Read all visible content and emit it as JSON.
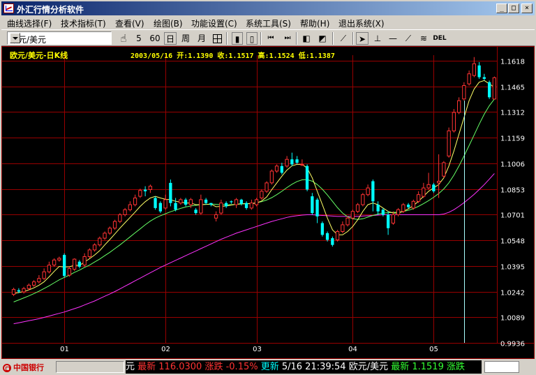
{
  "window": {
    "title": "外汇行情分析软件",
    "btn_min": "_",
    "btn_max": "□",
    "btn_close": "×"
  },
  "menu": [
    "曲线选择(F)",
    "技术指标(T)",
    "查看(V)",
    "绘图(B)",
    "功能设置(C)",
    "系统工具(S)",
    "帮助(H)",
    "退出系统(X)"
  ],
  "toolbar": {
    "instrument": "欧元/美元",
    "minute5": "5",
    "minute60": "60",
    "day": "日",
    "week": "周",
    "month": "月",
    "del": "DEL"
  },
  "chart": {
    "instrument_label": "欧元/美元-日K线",
    "info_line": "2003/05/16  开:1.1390  收:1.1517  高:1.1524  低:1.1387",
    "colors": {
      "up": "#ff3333",
      "down": "#00ffff",
      "grid": "#990000",
      "axis_text": "#ffffff",
      "ma_short": "#ffff66",
      "ma_mid": "#66ff66",
      "ma_long": "#ff33ff"
    }
  },
  "chart_data": {
    "type": "candlestick",
    "y_ticks": [
      "1.1618",
      "1.1465",
      "1.1312",
      "1.1159",
      "1.1006",
      "1.0853",
      "1.0701",
      "1.0548",
      "1.0395",
      "1.0242",
      "1.0089",
      "0.9936"
    ],
    "ylim": [
      0.9936,
      1.1618
    ],
    "x_ticks": [
      {
        "label": "01",
        "index": 10
      },
      {
        "label": "02",
        "index": 30
      },
      {
        "label": "03",
        "index": 48
      },
      {
        "label": "04",
        "index": 67
      },
      {
        "label": "05",
        "index": 83
      }
    ],
    "candles": [
      [
        1.0225,
        1.0255,
        1.0215,
        1.0265
      ],
      [
        1.025,
        1.0242,
        1.0232,
        1.0262
      ],
      [
        1.024,
        1.026,
        1.023,
        1.027
      ],
      [
        1.026,
        1.028,
        1.025,
        1.029
      ],
      [
        1.028,
        1.03,
        1.027,
        1.031
      ],
      [
        1.03,
        1.032,
        1.029,
        1.034
      ],
      [
        1.032,
        1.036,
        1.031,
        1.038
      ],
      [
        1.036,
        1.04,
        1.035,
        1.042
      ],
      [
        1.04,
        1.043,
        1.039,
        1.044
      ],
      [
        1.043,
        1.044,
        1.042,
        1.045
      ],
      [
        1.046,
        1.0335,
        1.0325,
        1.047
      ],
      [
        1.034,
        1.038,
        1.033,
        1.039
      ],
      [
        1.0375,
        1.0435,
        1.0365,
        1.044
      ],
      [
        1.042,
        1.039,
        1.038,
        1.043
      ],
      [
        1.04,
        1.045,
        1.039,
        1.047
      ],
      [
        1.045,
        1.049,
        1.044,
        1.05
      ],
      [
        1.049,
        1.052,
        1.048,
        1.053
      ],
      [
        1.052,
        1.056,
        1.051,
        1.057
      ],
      [
        1.056,
        1.059,
        1.055,
        1.06
      ],
      [
        1.059,
        1.062,
        1.058,
        1.063
      ],
      [
        1.062,
        1.066,
        1.061,
        1.067
      ],
      [
        1.066,
        1.07,
        1.065,
        1.071
      ],
      [
        1.07,
        1.073,
        1.069,
        1.074
      ],
      [
        1.073,
        1.076,
        1.072,
        1.078
      ],
      [
        1.076,
        1.08,
        1.075,
        1.082
      ],
      [
        1.081,
        1.0845,
        1.08,
        1.0855
      ],
      [
        1.085,
        1.084,
        1.081,
        1.087
      ],
      [
        1.085,
        1.087,
        1.083,
        1.088
      ],
      [
        1.08,
        1.074,
        1.073,
        1.081
      ],
      [
        1.077,
        1.072,
        1.071,
        1.078
      ],
      [
        1.074,
        1.079,
        1.073,
        1.082
      ],
      [
        1.089,
        1.077,
        1.075,
        1.091
      ],
      [
        1.077,
        1.073,
        1.072,
        1.08
      ],
      [
        1.077,
        1.079,
        1.076,
        1.08
      ],
      [
        1.079,
        1.076,
        1.075,
        1.08
      ],
      [
        1.076,
        1.079,
        1.074,
        1.08
      ],
      [
        1.073,
        1.071,
        1.07,
        1.074
      ],
      [
        1.071,
        1.079,
        1.07,
        1.082
      ],
      [
        1.079,
        1.077,
        1.076,
        1.08
      ],
      [
        1.077,
        1.076,
        1.075,
        1.077
      ],
      [
        1.068,
        1.07,
        1.066,
        1.072
      ],
      [
        1.071,
        1.077,
        1.07,
        1.079
      ],
      [
        1.077,
        1.075,
        1.074,
        1.078
      ],
      [
        1.078,
        1.0775,
        1.0765,
        1.0785
      ],
      [
        1.076,
        1.079,
        1.074,
        1.08
      ],
      [
        1.079,
        1.0765,
        1.0755,
        1.0795
      ],
      [
        1.077,
        1.074,
        1.073,
        1.078
      ],
      [
        1.074,
        1.077,
        1.073,
        1.079
      ],
      [
        1.076,
        1.079,
        1.075,
        1.08
      ],
      [
        1.08,
        1.084,
        1.079,
        1.085
      ],
      [
        1.084,
        1.089,
        1.083,
        1.09
      ],
      [
        1.089,
        1.096,
        1.088,
        1.097
      ],
      [
        1.096,
        1.099,
        1.095,
        1.1
      ],
      [
        1.099,
        1.095,
        1.094,
        1.101
      ],
      [
        1.099,
        1.103,
        1.098,
        1.105
      ],
      [
        1.103,
        1.1,
        1.099,
        1.107
      ],
      [
        1.103,
        1.101,
        1.1,
        1.105
      ],
      [
        1.1,
        1.1,
        1.099,
        1.103
      ],
      [
        1.099,
        1.085,
        1.084,
        1.1
      ],
      [
        1.081,
        1.071,
        1.07,
        1.083
      ],
      [
        1.079,
        1.069,
        1.065,
        1.08
      ],
      [
        1.065,
        1.058,
        1.057,
        1.066
      ],
      [
        1.059,
        1.055,
        1.054,
        1.06
      ],
      [
        1.056,
        1.052,
        1.051,
        1.057
      ],
      [
        1.055,
        1.06,
        1.054,
        1.061
      ],
      [
        1.06,
        1.064,
        1.059,
        1.066
      ],
      [
        1.064,
        1.068,
        1.063,
        1.069
      ],
      [
        1.068,
        1.072,
        1.067,
        1.073
      ],
      [
        1.072,
        1.076,
        1.071,
        1.077
      ],
      [
        1.076,
        1.082,
        1.075,
        1.083
      ],
      [
        1.082,
        1.086,
        1.081,
        1.088
      ],
      [
        1.09,
        1.078,
        1.072,
        1.091
      ],
      [
        1.076,
        1.072,
        1.07,
        1.078
      ],
      [
        1.073,
        1.07,
        1.069,
        1.074
      ],
      [
        1.07,
        1.062,
        1.058,
        1.072
      ],
      [
        1.065,
        1.07,
        1.064,
        1.072
      ],
      [
        1.07,
        1.073,
        1.069,
        1.074
      ],
      [
        1.072,
        1.076,
        1.071,
        1.077
      ],
      [
        1.076,
        1.0745,
        1.0735,
        1.077
      ],
      [
        1.074,
        1.078,
        1.073,
        1.079
      ],
      [
        1.078,
        1.082,
        1.077,
        1.084
      ],
      [
        1.081,
        1.086,
        1.08,
        1.089
      ],
      [
        1.086,
        1.088,
        1.085,
        1.095
      ],
      [
        1.088,
        1.084,
        1.083,
        1.089
      ],
      [
        1.089,
        1.09,
        1.08,
        1.106
      ],
      [
        1.093,
        1.101,
        1.092,
        1.102
      ],
      [
        1.105,
        1.12,
        1.104,
        1.122
      ],
      [
        1.12,
        1.131,
        1.119,
        1.133
      ],
      [
        1.131,
        1.138,
        1.13,
        1.14
      ],
      [
        1.139,
        1.147,
        1.138,
        1.149
      ],
      [
        1.148,
        1.154,
        1.147,
        1.156
      ],
      [
        1.153,
        1.16,
        1.152,
        1.164
      ],
      [
        1.159,
        1.152,
        1.151,
        1.161
      ],
      [
        1.152,
        1.151,
        1.15,
        1.154
      ],
      [
        1.149,
        1.14,
        1.139,
        1.15
      ],
      [
        1.139,
        1.1517,
        1.1387,
        1.1524
      ]
    ],
    "ma_short": [
      1.023,
      1.0236,
      1.0242,
      1.0252,
      1.0264,
      1.028,
      1.03,
      1.033,
      1.0362,
      1.0392,
      1.0388,
      1.039,
      1.0398,
      1.0398,
      1.0418,
      1.0438,
      1.046,
      1.0486,
      1.052,
      1.0552,
      1.0586,
      1.062,
      1.0652,
      1.0684,
      1.0716,
      1.075,
      1.0778,
      1.08,
      1.081,
      1.08,
      1.0792,
      1.079,
      1.078,
      1.0776,
      1.077,
      1.077,
      1.076,
      1.076,
      1.0762,
      1.0762,
      1.0748,
      1.075,
      1.0752,
      1.0758,
      1.0762,
      1.0766,
      1.0766,
      1.0766,
      1.077,
      1.0782,
      1.0806,
      1.085,
      1.089,
      1.093,
      1.0966,
      1.0992,
      1.1,
      1.1,
      1.0978,
      1.092,
      1.084,
      1.076,
      1.068,
      1.061,
      1.058,
      1.058,
      1.06,
      1.063,
      1.067,
      1.072,
      1.076,
      1.077,
      1.076,
      1.074,
      1.072,
      1.071,
      1.071,
      1.072,
      1.0735,
      1.0755,
      1.078,
      1.081,
      1.084,
      1.086,
      1.088,
      1.092,
      1.099,
      1.108,
      1.118,
      1.128,
      1.138,
      1.145,
      1.149,
      1.15,
      1.148,
      1.146
    ],
    "ma_mid": [
      1.018,
      1.0192,
      1.0204,
      1.0216,
      1.023,
      1.0244,
      1.026,
      1.0276,
      1.0294,
      1.0312,
      1.0326,
      1.034,
      1.0356,
      1.037,
      1.0386,
      1.04,
      1.0418,
      1.0436,
      1.0456,
      1.0476,
      1.0498,
      1.052,
      1.0544,
      1.0568,
      1.0592,
      1.0616,
      1.064,
      1.0662,
      1.068,
      1.0694,
      1.0706,
      1.0718,
      1.0728,
      1.0738,
      1.0746,
      1.0752,
      1.0756,
      1.076,
      1.0762,
      1.0764,
      1.0762,
      1.076,
      1.076,
      1.076,
      1.0762,
      1.0764,
      1.0766,
      1.0768,
      1.0772,
      1.0778,
      1.0788,
      1.0802,
      1.082,
      1.084,
      1.0862,
      1.0882,
      1.0898,
      1.0908,
      1.091,
      1.09,
      1.088,
      1.0852,
      1.0818,
      1.078,
      1.0742,
      1.071,
      1.0688,
      1.0676,
      1.0672,
      1.0676,
      1.0686,
      1.0696,
      1.0704,
      1.071,
      1.0712,
      1.0714,
      1.0716,
      1.072,
      1.0726,
      1.0736,
      1.075,
      1.0766,
      1.0784,
      1.0804,
      1.0826,
      1.0854,
      1.089,
      1.0936,
      1.099,
      1.105,
      1.1112,
      1.1176,
      1.124,
      1.13,
      1.135,
      1.139
    ],
    "ma_long": [
      1.005,
      1.0056,
      1.0062,
      1.0068,
      1.0074,
      1.008,
      1.0088,
      1.0096,
      1.0104,
      1.0112,
      1.012,
      1.013,
      1.014,
      1.015,
      1.0162,
      1.0174,
      1.0186,
      1.02,
      1.0214,
      1.0228,
      1.0242,
      1.0258,
      1.0274,
      1.029,
      1.0306,
      1.0322,
      1.0338,
      1.0354,
      1.037,
      1.0386,
      1.04,
      1.0414,
      1.0428,
      1.0442,
      1.0456,
      1.047,
      1.0484,
      1.0498,
      1.0512,
      1.0526,
      1.054,
      1.0554,
      1.0566,
      1.0578,
      1.059,
      1.06,
      1.061,
      1.062,
      1.063,
      1.064,
      1.065,
      1.066,
      1.0668,
      1.0676,
      1.0684,
      1.069,
      1.0694,
      1.0698,
      1.07,
      1.07,
      1.0698,
      1.0696,
      1.0694,
      1.0692,
      1.069,
      1.069,
      1.069,
      1.069,
      1.069,
      1.0692,
      1.0694,
      1.0696,
      1.0698,
      1.07,
      1.07,
      1.07,
      1.07,
      1.07,
      1.07,
      1.07,
      1.07,
      1.07,
      1.07,
      1.07,
      1.07,
      1.0704,
      1.0714,
      1.073,
      1.075,
      1.0772,
      1.0796,
      1.0822,
      1.085,
      1.088,
      1.0912,
      1.0946
    ],
    "cursor_index": 89
  },
  "statusbar": {
    "bank": "中国银行",
    "ticker": [
      {
        "text": "元 ",
        "color": "#ffffff"
      },
      {
        "text": "最新 ",
        "color": "#ff3333"
      },
      {
        "text": "116.0300 ",
        "color": "#ff3333"
      },
      {
        "text": "涨跌 ",
        "color": "#ff3333"
      },
      {
        "text": "-0.15% ",
        "color": "#ff3333"
      },
      {
        "text": "更新 ",
        "color": "#00ffff"
      },
      {
        "text": "5/16 21:39:54 ",
        "color": "#ffffff"
      },
      {
        "text": "欧元/美元 ",
        "color": "#ffffff"
      },
      {
        "text": "最新 ",
        "color": "#33ff33"
      },
      {
        "text": "1.1519 ",
        "color": "#33ff33"
      },
      {
        "text": "涨跌 ",
        "color": "#33ff33"
      }
    ]
  }
}
